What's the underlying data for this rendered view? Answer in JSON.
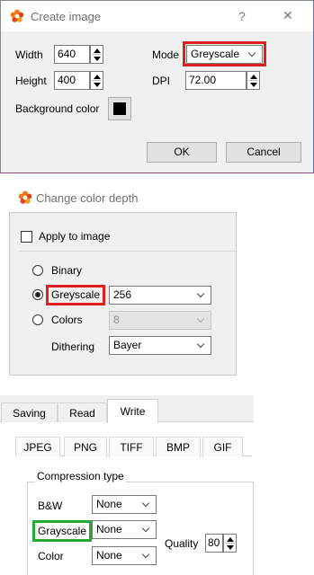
{
  "create_image": {
    "title": "Create image",
    "help": "?",
    "close": "✕",
    "width_label": "Width",
    "width_value": "640",
    "height_label": "Height",
    "height_value": "400",
    "mode_label": "Mode",
    "mode_value": "Greyscale",
    "dpi_label": "DPI",
    "dpi_value": "72.00",
    "bg_label": "Background color",
    "ok": "OK",
    "cancel": "Cancel"
  },
  "change_depth": {
    "title": "Change color depth",
    "apply_label": "Apply to image",
    "binary_label": "Binary",
    "greyscale_label": "Greyscale",
    "greyscale_value": "256",
    "colors_label": "Colors",
    "colors_value": "8",
    "dithering_label": "Dithering",
    "dithering_value": "Bayer"
  },
  "save_settings": {
    "tabs": [
      "Saving",
      "Read",
      "Write"
    ],
    "format_tabs": [
      "JPEG",
      "PNG",
      "TIFF",
      "BMP",
      "GIF"
    ],
    "group_label": "Compression type",
    "bw_label": "B&W",
    "bw_value": "None",
    "gray_label": "Grayscale",
    "gray_value": "None",
    "color_label": "Color",
    "color_value": "None",
    "quality_label": "Quality",
    "quality_value": "80"
  },
  "colors": {
    "highlight_red": "#e02020",
    "highlight_green": "#22aa33",
    "background_swatch": "#000000"
  }
}
